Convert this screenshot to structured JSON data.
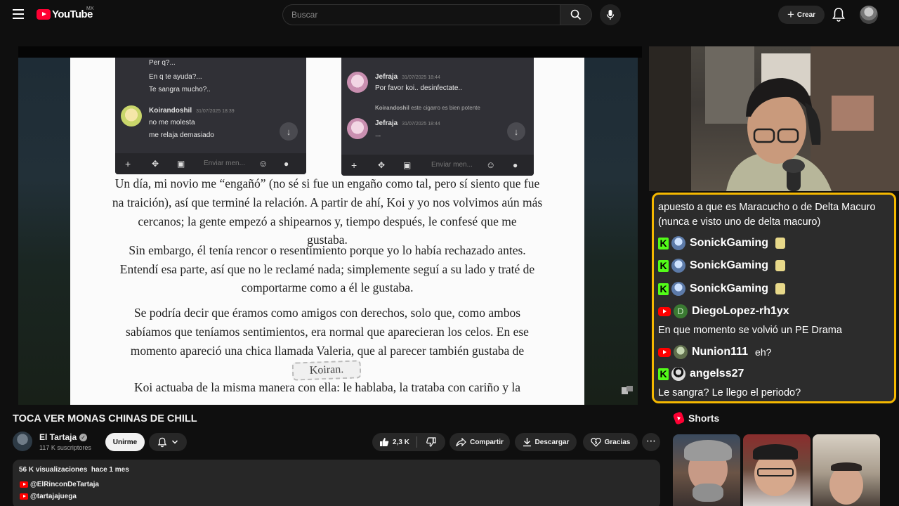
{
  "header": {
    "logo_text": "YouTube",
    "country": "MX",
    "search_placeholder": "Buscar",
    "create_label": "Crear"
  },
  "player": {
    "chat_screenshot_1": {
      "lines": [
        "Per q?...",
        "En q te ayuda?...",
        "Te sangra mucho?.."
      ],
      "name": "Koirandoshil",
      "time": "31/07/2025 18:39",
      "messages": [
        "no me molesta",
        "me relaja demasiado"
      ],
      "input_placeholder": "Enviar men..."
    },
    "chat_screenshot_2": {
      "name1": "Jefraja",
      "time1": "31/07/2025 18:44",
      "message1": "Por favor koi.. desinfectate..",
      "reply_name": "Koirandoshil",
      "reply_text": "este cigarro es bien potente",
      "name2": "Jefraja",
      "time2": "31/07/2025 18:44",
      "message2": "...",
      "input_placeholder": "Enviar men..."
    },
    "story_lines": [
      "Un día, mi novio me “engañó” (no sé si fue un engaño como tal, pero sí siento que fue",
      "na traición), así que terminé la relación. A partir de ahí, Koi y yo nos volvimos aún más",
      "cercanos; la gente empezó a shipearnos y, tiempo después, le confesé que me",
      "gustaba.",
      "Sin embargo, él tenía rencor o resentimiento porque yo lo había rechazado antes.",
      "Entendí esa parte, así que no le reclamé nada; simplemente seguí a su lado y traté de",
      "comportarme como a él le gustaba.",
      "Se podría decir que éramos como amigos con derechos, solo que, como ambos",
      "sabíamos que teníamos sentimientos, era normal que aparecieran los celos. En ese",
      "momento apareció una chica llamada Valeria, que al parecer también gustaba de",
      "Koi actuaba de la misma manera con ella: le hablaba, la trataba con cariño y la"
    ],
    "sticker_text": "Koiran."
  },
  "live_chat": {
    "top_message": [
      "apuesto a que es Maracucho o de Delta Macuro",
      "(nunca e visto uno de delta macuro)"
    ],
    "entries": [
      {
        "platform": "kick",
        "user": "SonickGaming",
        "emote": true
      },
      {
        "platform": "kick",
        "user": "SonickGaming",
        "emote": true
      },
      {
        "platform": "kick",
        "user": "SonickGaming",
        "emote": true
      },
      {
        "platform": "youtube",
        "user": "DiegoLopez-rh1yx",
        "initial": "D",
        "message": "En que momento se volvió un PE Drama"
      },
      {
        "platform": "youtube",
        "user": "Nunion111",
        "inline": "eh?"
      },
      {
        "platform": "kick",
        "user": "angelss27",
        "message": "Le sangra? Le llego el periodo?"
      }
    ]
  },
  "video": {
    "title": "TOCA VER MONAS CHINAS DE CHILL",
    "channel": "El Tartaja",
    "subscribers": "117 K suscriptores",
    "join_label": "Unirme",
    "likes": "2,3 K",
    "share_label": "Compartir",
    "download_label": "Descargar",
    "thanks_label": "Gracias"
  },
  "description": {
    "views": "56 K visualizaciones",
    "date": "hace 1 mes",
    "links": [
      "@ElRinconDeTartaja",
      "@tartajajuega"
    ]
  },
  "shorts": {
    "title": "Shorts"
  },
  "colors": {
    "brand_red": "#ff0033",
    "kick_green": "#53fc18",
    "chat_border": "#f5b800",
    "background": "#0f0f0f"
  }
}
